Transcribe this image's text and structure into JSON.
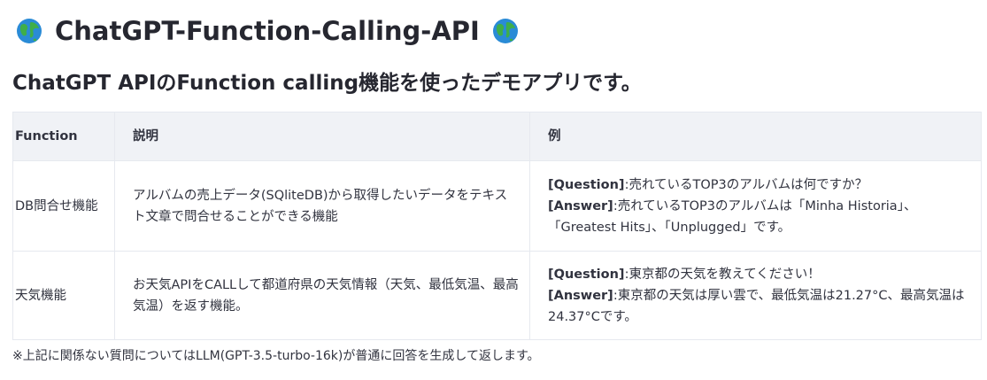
{
  "header": {
    "title": "ChatGPT-Function-Calling-API",
    "left_icon": "globe-icon",
    "right_icon": "globe-icon",
    "subtitle": "ChatGPT APIのFunction calling機能を使ったデモアプリです。"
  },
  "table": {
    "headers": {
      "function": "Function",
      "description": "説明",
      "example": "例"
    },
    "rows": [
      {
        "function": "DB問合せ機能",
        "description": "アルバムの売上データ(SQliteDB)から取得したいデータをテキスト文章で問合せることができる機能",
        "question_label": "[Question]",
        "question_text": ":売れているTOP3のアルバムは何ですか？",
        "answer_label": "[Answer]",
        "answer_text": ":売れているTOP3のアルバムは「Minha Historia」、「Greatest Hits」、「Unplugged」です。"
      },
      {
        "function": "天気機能",
        "description": "お天気APIをCALLして都道府県の天気情報（天気、最低気温、最高気温）を返す機能。",
        "question_label": "[Question]",
        "question_text": ":東京都の天気を教えてください！",
        "answer_label": "[Answer]",
        "answer_text": ":東京都の天気は厚い雲で、最低気温は21.27°C、最高気温は24.37°Cです。"
      }
    ]
  },
  "footnote": "※上記に関係ない質問についてはLLM(GPT-3.5-turbo-16k)が普通に回答を生成して返します。",
  "colors": {
    "text": "#31333f",
    "header_bg": "#f0f2f6",
    "border": "#e6e9ef",
    "globe_ocean": "#2a8bd6",
    "globe_land": "#3fae49"
  }
}
